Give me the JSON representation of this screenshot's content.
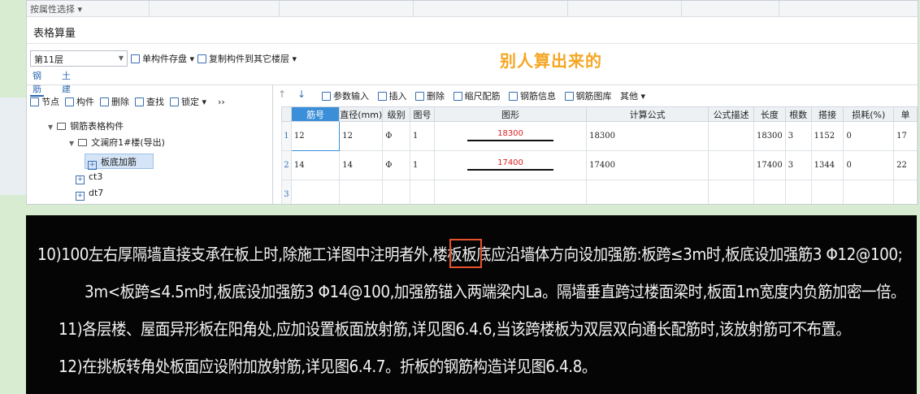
{
  "strip": {
    "label": "按属性选择 ▾"
  },
  "window": {
    "title": "表格算量",
    "floor": "第11层",
    "toolbar1": [
      "单构件存盘 ▾",
      "复制构件到其它楼层 ▾"
    ],
    "annotation": "别人算出来的",
    "tabs": [
      "钢筋",
      "土建"
    ]
  },
  "left_panel": {
    "toolbar": [
      "节点",
      "构件",
      "删除",
      "查找",
      "锁定 ▾",
      "››"
    ],
    "tree": {
      "root": "钢筋表格构件",
      "child": "文澜府1#楼(导出)",
      "selected": "板底加筋",
      "others": [
        "ct3",
        "dt7"
      ]
    }
  },
  "grid_toolbar": [
    "参数输入",
    "插入",
    "删除",
    "缩尺配筋",
    "钢筋信息",
    "钢筋图库",
    "其他 ▾"
  ],
  "table": {
    "headers": [
      "筋号",
      "直径(mm)",
      "级别",
      "图号",
      "图形",
      "计算公式",
      "公式描述",
      "长度",
      "根数",
      "搭接",
      "损耗(%)",
      "单"
    ],
    "rows": [
      {
        "rowno": "1",
        "jinhao": "12",
        "diameter": "12",
        "grade": "Φ",
        "tuhao": "1",
        "shape": "18300",
        "formula": "18300",
        "desc": "",
        "length": "18300",
        "count": "3",
        "lap": "1152",
        "loss": "0",
        "unit": "17"
      },
      {
        "rowno": "2",
        "jinhao": "14",
        "diameter": "14",
        "grade": "Φ",
        "tuhao": "1",
        "shape": "17400",
        "formula": "17400",
        "desc": "",
        "length": "17400",
        "count": "3",
        "lap": "1344",
        "loss": "0",
        "unit": "22"
      },
      {
        "rowno": "3"
      }
    ]
  },
  "document": {
    "lines": [
      "10)100左右厚隔墙直接支承在板上时,除施工详图中注明者外,楼板板底应沿墙体方向设加强筋:板跨≤3m时,板底设加强筋3 Φ12@100;",
      "3m<板跨≤4.5m时,板底设加强筋3 Φ14@100,加强筋锚入两端梁内La。隔墙垂直跨过楼面梁时,板面1m宽度内负筋加密一倍。",
      "11)各层楼、屋面异形板在阳角处,应加设置板面放射筋,详见图6.4.6,当该跨楼板为双层双向通长配筋时,该放射筋可不布置。",
      "12)在挑板转角处板面应设附加放射筋,详见图6.4.7。折板的钢筋构造详见图6.4.8。"
    ]
  }
}
